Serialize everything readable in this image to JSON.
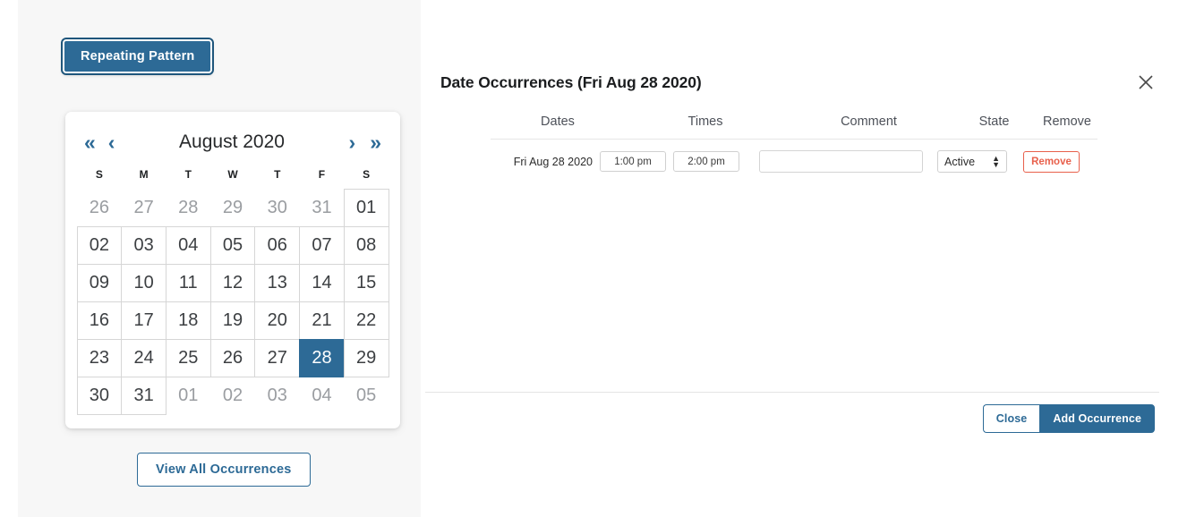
{
  "left_panel": {
    "repeating_pattern_button": "Repeating Pattern",
    "view_all_button": "View All Occurrences"
  },
  "calendar": {
    "title": "August 2020",
    "nav": {
      "prev_year": "«",
      "prev_month": "‹",
      "next_month": "›",
      "next_year": "»"
    },
    "weekdays": [
      "S",
      "M",
      "T",
      "W",
      "T",
      "F",
      "S"
    ],
    "selected_day": "28",
    "weeks": [
      [
        {
          "label": "26",
          "muted": true
        },
        {
          "label": "27",
          "muted": true
        },
        {
          "label": "28",
          "muted": true
        },
        {
          "label": "29",
          "muted": true
        },
        {
          "label": "30",
          "muted": true
        },
        {
          "label": "31",
          "muted": true
        },
        {
          "label": "01",
          "muted": false
        }
      ],
      [
        {
          "label": "02",
          "muted": false
        },
        {
          "label": "03",
          "muted": false
        },
        {
          "label": "04",
          "muted": false
        },
        {
          "label": "05",
          "muted": false
        },
        {
          "label": "06",
          "muted": false
        },
        {
          "label": "07",
          "muted": false
        },
        {
          "label": "08",
          "muted": false
        }
      ],
      [
        {
          "label": "09",
          "muted": false
        },
        {
          "label": "10",
          "muted": false
        },
        {
          "label": "11",
          "muted": false
        },
        {
          "label": "12",
          "muted": false
        },
        {
          "label": "13",
          "muted": false
        },
        {
          "label": "14",
          "muted": false
        },
        {
          "label": "15",
          "muted": false
        }
      ],
      [
        {
          "label": "16",
          "muted": false
        },
        {
          "label": "17",
          "muted": false
        },
        {
          "label": "18",
          "muted": false
        },
        {
          "label": "19",
          "muted": false
        },
        {
          "label": "20",
          "muted": false
        },
        {
          "label": "21",
          "muted": false
        },
        {
          "label": "22",
          "muted": false
        }
      ],
      [
        {
          "label": "23",
          "muted": false
        },
        {
          "label": "24",
          "muted": false
        },
        {
          "label": "25",
          "muted": false
        },
        {
          "label": "26",
          "muted": false
        },
        {
          "label": "27",
          "muted": false
        },
        {
          "label": "28",
          "muted": false,
          "selected": true
        },
        {
          "label": "29",
          "muted": false
        }
      ],
      [
        {
          "label": "30",
          "muted": false
        },
        {
          "label": "31",
          "muted": false
        },
        {
          "label": "01",
          "muted": true
        },
        {
          "label": "02",
          "muted": true
        },
        {
          "label": "03",
          "muted": true
        },
        {
          "label": "04",
          "muted": true
        },
        {
          "label": "05",
          "muted": true
        }
      ]
    ]
  },
  "modal": {
    "title": "Date Occurrences (Fri Aug 28 2020)",
    "close_icon": "close-icon",
    "columns": [
      "Dates",
      "Times",
      "Comment",
      "State",
      "Remove"
    ],
    "rows": [
      {
        "date": "Fri Aug 28 2020",
        "start_time": "1:00 pm",
        "end_time": "2:00 pm",
        "comment": "",
        "comment_placeholder": "",
        "state": "Active",
        "remove_label": "Remove"
      }
    ],
    "footer": {
      "close_label": "Close",
      "add_label": "Add Occurrence"
    }
  },
  "colors": {
    "accent_blue": "#2d6a96",
    "panel_gray": "#f7f7f7",
    "danger_red": "#e8604c"
  }
}
